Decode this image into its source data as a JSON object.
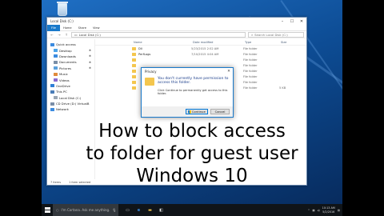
{
  "desktop": {
    "recycle_bin_label": "Recycle Bin"
  },
  "explorer": {
    "title": "Local Disk (C:)",
    "ribbon_tabs": [
      "File",
      "Home",
      "Share",
      "View"
    ],
    "address": "Local Disk (C:)",
    "search_placeholder": "Search Local Disk (C:)",
    "columns": [
      "Name",
      "Date modified",
      "Type",
      "Size"
    ],
    "files": [
      {
        "name": "Dll",
        "date": "5/23/2015 2:52 AM",
        "type": "File folder",
        "size": ""
      },
      {
        "name": "PerfLogs",
        "date": "7/10/2015 4:04 AM",
        "type": "File folder",
        "size": ""
      },
      {
        "name": "",
        "date": "",
        "type": "File folder",
        "size": ""
      },
      {
        "name": "",
        "date": "",
        "type": "File folder",
        "size": ""
      },
      {
        "name": "",
        "date": "",
        "type": "File folder",
        "size": ""
      },
      {
        "name": "",
        "date": "",
        "type": "File folder",
        "size": ""
      },
      {
        "name": "",
        "date": "",
        "type": "File folder",
        "size": ""
      },
      {
        "name": "",
        "date": "",
        "type": "File folder",
        "size": "5 KB"
      }
    ],
    "nav_items": [
      {
        "label": "Quick access",
        "indent": false,
        "pinned": false
      },
      {
        "label": "Desktop",
        "indent": true,
        "pinned": true
      },
      {
        "label": "Downloads",
        "indent": true,
        "pinned": true
      },
      {
        "label": "Documents",
        "indent": true,
        "pinned": true
      },
      {
        "label": "Pictures",
        "indent": true,
        "pinned": true
      },
      {
        "label": "Music",
        "indent": true,
        "pinned": false
      },
      {
        "label": "Videos",
        "indent": true,
        "pinned": false
      },
      {
        "label": "OneDrive",
        "indent": false,
        "pinned": false
      },
      {
        "label": "This PC",
        "indent": false,
        "pinned": false
      },
      {
        "label": "Local Disk (C:)",
        "indent": true,
        "pinned": false
      },
      {
        "label": "CD Drive (D:) VirtualB",
        "indent": false,
        "pinned": false
      },
      {
        "label": "Network",
        "indent": false,
        "pinned": false
      }
    ],
    "status_items": "7 items",
    "status_selected": "1 item selected"
  },
  "dialog": {
    "title": "Privacy",
    "message": "You don't currently have permission to access this folder.",
    "sub_message": "Click Continue to permanently get access to this folder.",
    "continue_label": "Continue",
    "cancel_label": "Cancel"
  },
  "caption": {
    "line1": "How to block access",
    "line2": "to folder for guest user",
    "line3": "Windows 10"
  },
  "taskbar": {
    "cortana_placeholder": "I'm Cortana. Ask me anything.",
    "time": "10:13 AM",
    "date": "5/2/2016"
  },
  "colors": {
    "accent": "#1979ca",
    "dialog_message": "#1a3d8a",
    "folder": "#f4c64e",
    "taskbar": "#101418"
  }
}
